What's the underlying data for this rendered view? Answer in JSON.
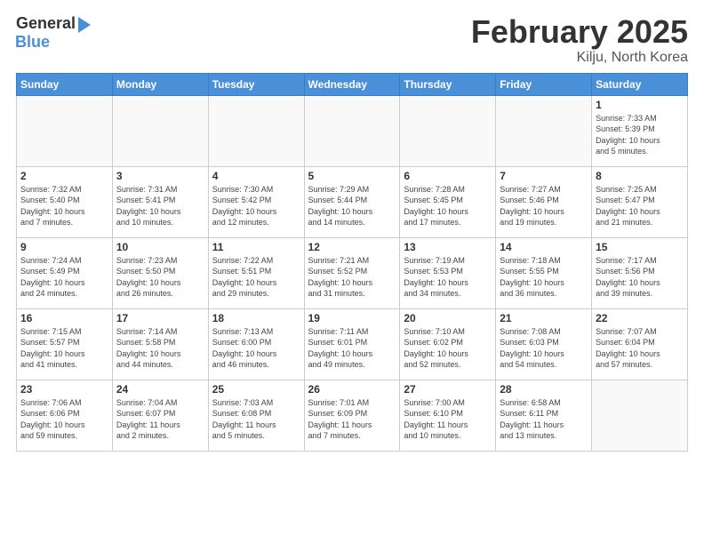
{
  "header": {
    "logo_general": "General",
    "logo_blue": "Blue",
    "month_title": "February 2025",
    "location": "Kilju, North Korea"
  },
  "days_of_week": [
    "Sunday",
    "Monday",
    "Tuesday",
    "Wednesday",
    "Thursday",
    "Friday",
    "Saturday"
  ],
  "weeks": [
    [
      {
        "day": "",
        "info": ""
      },
      {
        "day": "",
        "info": ""
      },
      {
        "day": "",
        "info": ""
      },
      {
        "day": "",
        "info": ""
      },
      {
        "day": "",
        "info": ""
      },
      {
        "day": "",
        "info": ""
      },
      {
        "day": "1",
        "info": "Sunrise: 7:33 AM\nSunset: 5:39 PM\nDaylight: 10 hours\nand 5 minutes."
      }
    ],
    [
      {
        "day": "2",
        "info": "Sunrise: 7:32 AM\nSunset: 5:40 PM\nDaylight: 10 hours\nand 7 minutes."
      },
      {
        "day": "3",
        "info": "Sunrise: 7:31 AM\nSunset: 5:41 PM\nDaylight: 10 hours\nand 10 minutes."
      },
      {
        "day": "4",
        "info": "Sunrise: 7:30 AM\nSunset: 5:42 PM\nDaylight: 10 hours\nand 12 minutes."
      },
      {
        "day": "5",
        "info": "Sunrise: 7:29 AM\nSunset: 5:44 PM\nDaylight: 10 hours\nand 14 minutes."
      },
      {
        "day": "6",
        "info": "Sunrise: 7:28 AM\nSunset: 5:45 PM\nDaylight: 10 hours\nand 17 minutes."
      },
      {
        "day": "7",
        "info": "Sunrise: 7:27 AM\nSunset: 5:46 PM\nDaylight: 10 hours\nand 19 minutes."
      },
      {
        "day": "8",
        "info": "Sunrise: 7:25 AM\nSunset: 5:47 PM\nDaylight: 10 hours\nand 21 minutes."
      }
    ],
    [
      {
        "day": "9",
        "info": "Sunrise: 7:24 AM\nSunset: 5:49 PM\nDaylight: 10 hours\nand 24 minutes."
      },
      {
        "day": "10",
        "info": "Sunrise: 7:23 AM\nSunset: 5:50 PM\nDaylight: 10 hours\nand 26 minutes."
      },
      {
        "day": "11",
        "info": "Sunrise: 7:22 AM\nSunset: 5:51 PM\nDaylight: 10 hours\nand 29 minutes."
      },
      {
        "day": "12",
        "info": "Sunrise: 7:21 AM\nSunset: 5:52 PM\nDaylight: 10 hours\nand 31 minutes."
      },
      {
        "day": "13",
        "info": "Sunrise: 7:19 AM\nSunset: 5:53 PM\nDaylight: 10 hours\nand 34 minutes."
      },
      {
        "day": "14",
        "info": "Sunrise: 7:18 AM\nSunset: 5:55 PM\nDaylight: 10 hours\nand 36 minutes."
      },
      {
        "day": "15",
        "info": "Sunrise: 7:17 AM\nSunset: 5:56 PM\nDaylight: 10 hours\nand 39 minutes."
      }
    ],
    [
      {
        "day": "16",
        "info": "Sunrise: 7:15 AM\nSunset: 5:57 PM\nDaylight: 10 hours\nand 41 minutes."
      },
      {
        "day": "17",
        "info": "Sunrise: 7:14 AM\nSunset: 5:58 PM\nDaylight: 10 hours\nand 44 minutes."
      },
      {
        "day": "18",
        "info": "Sunrise: 7:13 AM\nSunset: 6:00 PM\nDaylight: 10 hours\nand 46 minutes."
      },
      {
        "day": "19",
        "info": "Sunrise: 7:11 AM\nSunset: 6:01 PM\nDaylight: 10 hours\nand 49 minutes."
      },
      {
        "day": "20",
        "info": "Sunrise: 7:10 AM\nSunset: 6:02 PM\nDaylight: 10 hours\nand 52 minutes."
      },
      {
        "day": "21",
        "info": "Sunrise: 7:08 AM\nSunset: 6:03 PM\nDaylight: 10 hours\nand 54 minutes."
      },
      {
        "day": "22",
        "info": "Sunrise: 7:07 AM\nSunset: 6:04 PM\nDaylight: 10 hours\nand 57 minutes."
      }
    ],
    [
      {
        "day": "23",
        "info": "Sunrise: 7:06 AM\nSunset: 6:06 PM\nDaylight: 10 hours\nand 59 minutes."
      },
      {
        "day": "24",
        "info": "Sunrise: 7:04 AM\nSunset: 6:07 PM\nDaylight: 11 hours\nand 2 minutes."
      },
      {
        "day": "25",
        "info": "Sunrise: 7:03 AM\nSunset: 6:08 PM\nDaylight: 11 hours\nand 5 minutes."
      },
      {
        "day": "26",
        "info": "Sunrise: 7:01 AM\nSunset: 6:09 PM\nDaylight: 11 hours\nand 7 minutes."
      },
      {
        "day": "27",
        "info": "Sunrise: 7:00 AM\nSunset: 6:10 PM\nDaylight: 11 hours\nand 10 minutes."
      },
      {
        "day": "28",
        "info": "Sunrise: 6:58 AM\nSunset: 6:11 PM\nDaylight: 11 hours\nand 13 minutes."
      },
      {
        "day": "",
        "info": ""
      }
    ]
  ]
}
